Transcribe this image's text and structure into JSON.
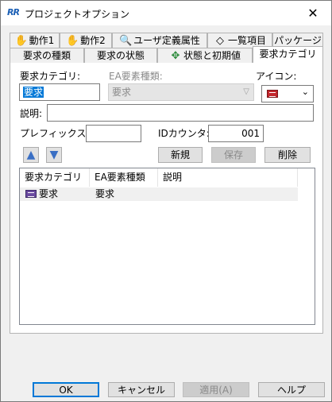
{
  "window": {
    "title": "プロジェクトオプション",
    "app_icon": "RR",
    "close_glyph": "✕"
  },
  "tabs_row1": [
    {
      "label": "動作1",
      "icon": "hand-icon",
      "glyph": "✋"
    },
    {
      "label": "動作2",
      "icon": "hand-icon",
      "glyph": "✋"
    },
    {
      "label": "ユーザ定義属性",
      "icon": "search-icon",
      "glyph": "🔍"
    },
    {
      "label": "一覧項目",
      "icon": "diamond-icon",
      "glyph": "◇"
    },
    {
      "label": "パッケージ"
    }
  ],
  "tabs_row2": [
    {
      "label": "要求の種類"
    },
    {
      "label": "要求の状態"
    },
    {
      "label": "状態と初期値",
      "icon": "diamond-arrows-icon",
      "glyph": "✥"
    },
    {
      "label": "要求カテゴリ"
    }
  ],
  "form": {
    "category_label": "要求カテゴリ:",
    "category_value": "要求",
    "ea_type_label": "EA要素種類:",
    "ea_type_value": "要求",
    "icon_label": "アイコン:",
    "desc_label": "説明:",
    "desc_value": "",
    "prefix_label": "プレフィックス:",
    "prefix_value": "",
    "idcounter_label": "IDカウンタ:",
    "idcounter_value": "001",
    "up_glyph": "▲",
    "down_glyph": "▼",
    "new_label": "新規",
    "save_label": "保存",
    "delete_label": "削除"
  },
  "list": {
    "columns": [
      "要求カテゴリ",
      "EA要素種類",
      "説明"
    ],
    "rows": [
      {
        "category": "要求",
        "ea_type": "要求",
        "desc": ""
      }
    ]
  },
  "footer": {
    "ok": "OK",
    "cancel": "キャンセル",
    "apply": "適用(A)",
    "help": "ヘルプ"
  }
}
